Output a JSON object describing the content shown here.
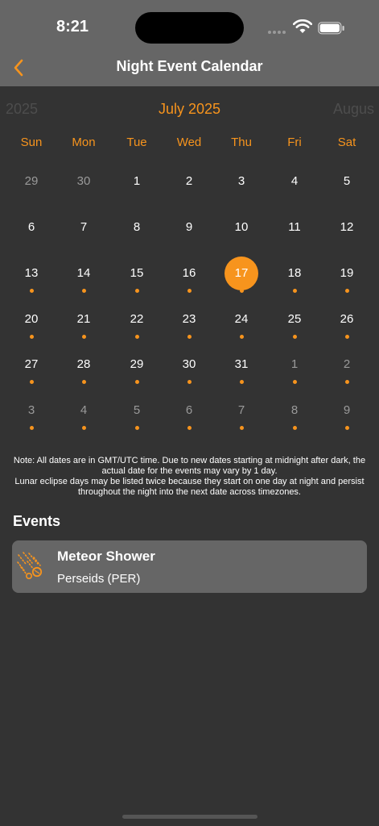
{
  "status_bar": {
    "time": "8:21"
  },
  "nav": {
    "title": "Night Event Calendar",
    "back_icon": "chevron-left-icon"
  },
  "calendar": {
    "prev_month": "2025",
    "current_month": "July 2025",
    "next_month": "Augus",
    "weekdays": [
      "Sun",
      "Mon",
      "Tue",
      "Wed",
      "Thu",
      "Fri",
      "Sat"
    ],
    "selected_day": "17",
    "weeks": [
      [
        {
          "day": "29",
          "muted": true,
          "event": false
        },
        {
          "day": "30",
          "muted": true,
          "event": false
        },
        {
          "day": "1",
          "muted": false,
          "event": false
        },
        {
          "day": "2",
          "muted": false,
          "event": false
        },
        {
          "day": "3",
          "muted": false,
          "event": false
        },
        {
          "day": "4",
          "muted": false,
          "event": false
        },
        {
          "day": "5",
          "muted": false,
          "event": false
        }
      ],
      [
        {
          "day": "6",
          "muted": false,
          "event": false
        },
        {
          "day": "7",
          "muted": false,
          "event": false
        },
        {
          "day": "8",
          "muted": false,
          "event": false
        },
        {
          "day": "9",
          "muted": false,
          "event": false
        },
        {
          "day": "10",
          "muted": false,
          "event": false
        },
        {
          "day": "11",
          "muted": false,
          "event": false
        },
        {
          "day": "12",
          "muted": false,
          "event": false
        }
      ],
      [
        {
          "day": "13",
          "muted": false,
          "event": true
        },
        {
          "day": "14",
          "muted": false,
          "event": true
        },
        {
          "day": "15",
          "muted": false,
          "event": true
        },
        {
          "day": "16",
          "muted": false,
          "event": true
        },
        {
          "day": "17",
          "muted": false,
          "event": true
        },
        {
          "day": "18",
          "muted": false,
          "event": true
        },
        {
          "day": "19",
          "muted": false,
          "event": true
        }
      ],
      [
        {
          "day": "20",
          "muted": false,
          "event": true
        },
        {
          "day": "21",
          "muted": false,
          "event": true
        },
        {
          "day": "22",
          "muted": false,
          "event": true
        },
        {
          "day": "23",
          "muted": false,
          "event": true
        },
        {
          "day": "24",
          "muted": false,
          "event": true
        },
        {
          "day": "25",
          "muted": false,
          "event": true
        },
        {
          "day": "26",
          "muted": false,
          "event": true
        }
      ],
      [
        {
          "day": "27",
          "muted": false,
          "event": true
        },
        {
          "day": "28",
          "muted": false,
          "event": true
        },
        {
          "day": "29",
          "muted": false,
          "event": true
        },
        {
          "day": "30",
          "muted": false,
          "event": true
        },
        {
          "day": "31",
          "muted": false,
          "event": true
        },
        {
          "day": "1",
          "muted": true,
          "event": true
        },
        {
          "day": "2",
          "muted": true,
          "event": true
        }
      ],
      [
        {
          "day": "3",
          "muted": true,
          "event": true
        },
        {
          "day": "4",
          "muted": true,
          "event": true
        },
        {
          "day": "5",
          "muted": true,
          "event": true
        },
        {
          "day": "6",
          "muted": true,
          "event": true
        },
        {
          "day": "7",
          "muted": true,
          "event": true
        },
        {
          "day": "8",
          "muted": true,
          "event": true
        },
        {
          "day": "9",
          "muted": true,
          "event": true
        }
      ]
    ]
  },
  "note": {
    "line1": "Note: All dates are in GMT/UTC time. Due to new dates starting at midnight after dark, the actual date for the events may vary by 1 day.",
    "line2": "Lunar eclipse days may be listed twice because they start on one day at night and persist throughout the night into the next date across timezones."
  },
  "events": {
    "heading": "Events",
    "items": [
      {
        "icon": "meteor-icon",
        "title": "Meteor Shower",
        "subtitle": "Perseids (PER)"
      }
    ]
  },
  "colors": {
    "accent": "#f7941d",
    "background": "#333333",
    "bar": "#666666",
    "muted_text": "#9a9a9a",
    "faded_text": "#4d4d4d"
  }
}
